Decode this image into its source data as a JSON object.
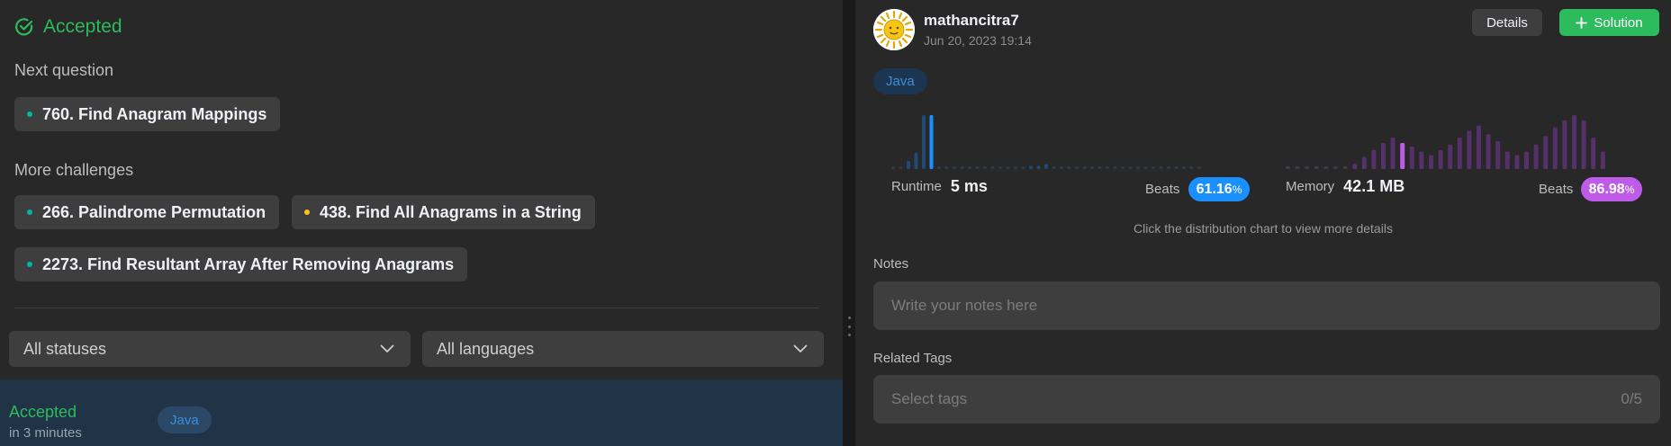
{
  "left": {
    "status": "Accepted",
    "next_question_label": "Next question",
    "next_question": {
      "title": "760. Find Anagram Mappings",
      "difficulty_color": "#00b8a3"
    },
    "more_challenges_label": "More challenges",
    "challenges": [
      {
        "title": "266. Palindrome Permutation",
        "difficulty_color": "#00b8a3"
      },
      {
        "title": "438. Find All Anagrams in a String",
        "difficulty_color": "#ffc01e"
      },
      {
        "title": "2273. Find Resultant Array After Removing Anagrams",
        "difficulty_color": "#00b8a3"
      }
    ],
    "filters": {
      "status": "All statuses",
      "language": "All languages"
    },
    "submission": {
      "status": "Accepted",
      "time": "in 3 minutes",
      "language": "Java"
    }
  },
  "right": {
    "user": {
      "name": "mathancitra7",
      "date": "Jun 20, 2023 19:14",
      "avatar_icon": "sun-face-icon"
    },
    "buttons": {
      "details": "Details",
      "solution": "Solution",
      "solution_icon": "plus-icon"
    },
    "language": "Java",
    "runtime": {
      "label": "Runtime",
      "value": "5 ms",
      "beats_label": "Beats",
      "beats_value": "61.16",
      "beats_unit": "%",
      "color": "#1a90ff"
    },
    "memory": {
      "label": "Memory",
      "value": "42.1 MB",
      "beats_label": "Beats",
      "beats_value": "86.98",
      "beats_unit": "%",
      "color": "#be5ce9"
    },
    "hint": "Click the distribution chart to view more details",
    "notes": {
      "label": "Notes",
      "placeholder": "Write your notes here"
    },
    "related_tags": {
      "label": "Related Tags",
      "placeholder": "Select tags",
      "count": "0/5"
    }
  },
  "chart_data": [
    {
      "type": "bar",
      "name": "runtime-distribution",
      "values": [
        1,
        1,
        5,
        10,
        33,
        33,
        1,
        1,
        1,
        1,
        1,
        1,
        1,
        1,
        1,
        1,
        1,
        1,
        2,
        2,
        3,
        1,
        1,
        1,
        1,
        1,
        1,
        1,
        1,
        1,
        1,
        1,
        1,
        1,
        1,
        1,
        1,
        1,
        1,
        1,
        1
      ],
      "highlight_index": 5
    },
    {
      "type": "bar",
      "name": "memory-distribution",
      "values": [
        1,
        1,
        1,
        1,
        1,
        1,
        1,
        3,
        7,
        11,
        15,
        18,
        15,
        13,
        10,
        8,
        11,
        14,
        18,
        22,
        25,
        20,
        16,
        10,
        8,
        10,
        14,
        19,
        24,
        28,
        31,
        28,
        18,
        10
      ],
      "highlight_index": 12
    }
  ]
}
